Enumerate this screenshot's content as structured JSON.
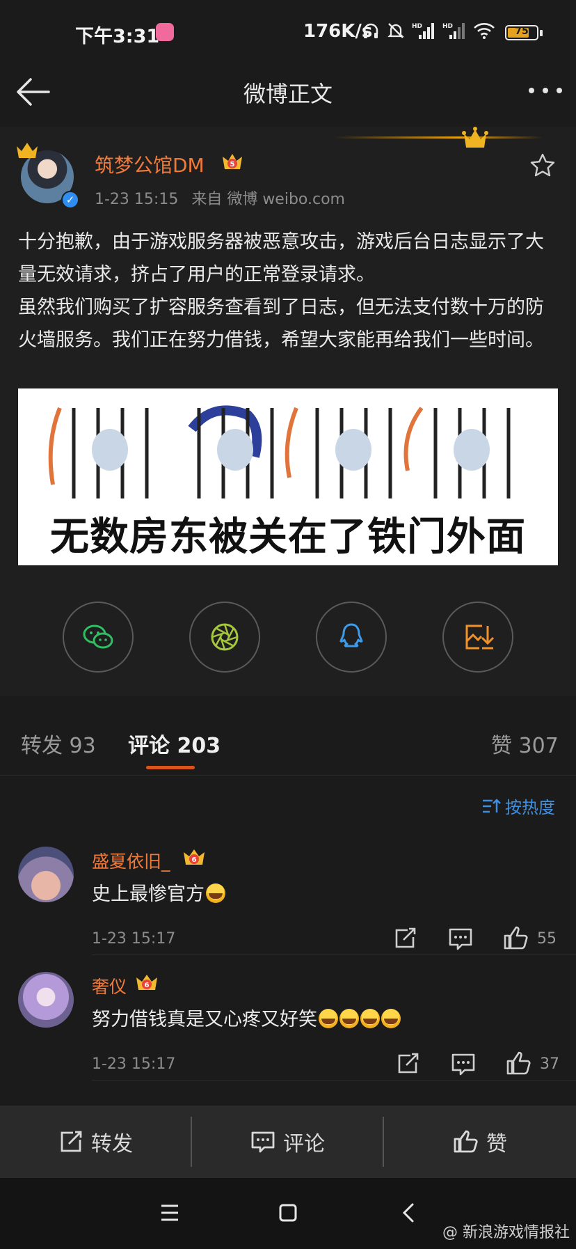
{
  "status_bar": {
    "time": "下午3:31",
    "net_speed": "176K/s",
    "battery": "75",
    "battery_level": 0.75
  },
  "nav": {
    "title": "微博正文"
  },
  "post": {
    "author": "筑梦公馆DM",
    "date": "1-23 15:15",
    "source": "来自 微博 weibo.com",
    "paragraphs": [
      "十分抱歉，由于游戏服务器被恶意攻击，游戏后台日志显示了大量无效请求，挤占了用户的正常登录请求。",
      "虽然我们购买了扩容服务查看到了日志，但无法支付数十万的防火墙服务。我们正在努力借钱，希望大家能再给我们一些时间。"
    ],
    "image_caption": "无数房东被关在了铁门外面"
  },
  "share": {
    "icons": [
      "wechat-icon",
      "moments-icon",
      "qq-icon",
      "save-image-icon"
    ]
  },
  "tabs": {
    "repost_label": "转发",
    "repost_count": "93",
    "comment_label": "评论",
    "comment_count": "203",
    "like_label": "赞",
    "like_count": "307"
  },
  "sort": {
    "label": "按热度"
  },
  "comments": [
    {
      "name": "盛夏依旧_",
      "text": "史上最惨官方",
      "emojis": 1,
      "time": "1-23 15:17",
      "likes": "55"
    },
    {
      "name": "奢仪",
      "text": "努力借钱真是又心疼又好笑",
      "emojis": 4,
      "time": "1-23 15:17",
      "likes": "37"
    }
  ],
  "bottom_bar": {
    "repost": "转发",
    "comment": "评论",
    "like": "赞"
  },
  "watermark": "@ 新浪游戏情报社",
  "colors": {
    "background": "#1b1b1b",
    "card": "#1f1f1f",
    "username": "#f07a3a",
    "accent_underline": "#d9541a",
    "link_blue": "#3f8fe0",
    "verify_blue": "#2f8ef0"
  }
}
